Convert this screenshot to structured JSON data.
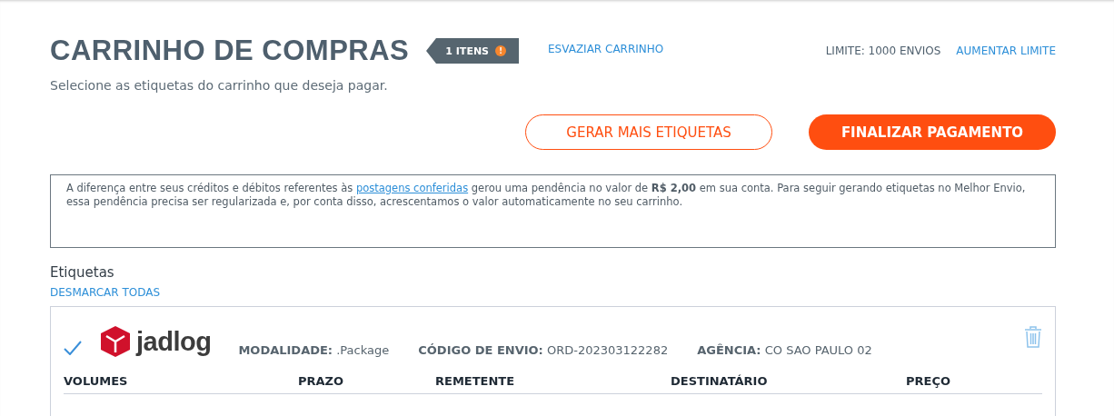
{
  "header": {
    "title": "CARRINHO DE COMPRAS",
    "badge": "1 ITENS",
    "badge_alert": "!",
    "clear_link": "ESVAZIAR CARRINHO",
    "limit": "LIMITE: 1000 ENVIOS",
    "limit_link": "AUMENTAR LIMITE"
  },
  "subtitle": "Selecione as etiquetas do carrinho que deseja pagar.",
  "actions": {
    "secondary": "GERAR MAIS ETIQUETAS",
    "primary": "FINALIZAR PAGAMENTO"
  },
  "notice": {
    "before": "A diferença entre seus créditos e débitos referentes às ",
    "link": "postagens conferidas",
    "after": " gerou uma pendência no valor de **R$ 2,00** em sua conta. Para seguir gerando etiquetas no Melhor Envio, essa pendência precisa ser regularizada e, por conta disso, acrescentamos o valor automaticamente no seu carrinho."
  },
  "labels_section": {
    "title": "Etiquetas",
    "toggle_link": "DESMARCAR TODAS"
  },
  "shipments": [
    {
      "checked": true,
      "carrier": "jadlog",
      "fields": [
        {
          "label": "MODALIDADE:",
          "value": ".Package"
        },
        {
          "label": "CÓDIGO DE ENVIO:",
          "value": "ORD-202303122282"
        },
        {
          "label": "AGÊNCIA:",
          "value": "CO SAO PAULO 02"
        }
      ],
      "columns": [
        "VOLUMES",
        "PRAZO",
        "REMETENTE",
        "DESTINATÁRIO",
        "PREÇO"
      ]
    }
  ]
}
